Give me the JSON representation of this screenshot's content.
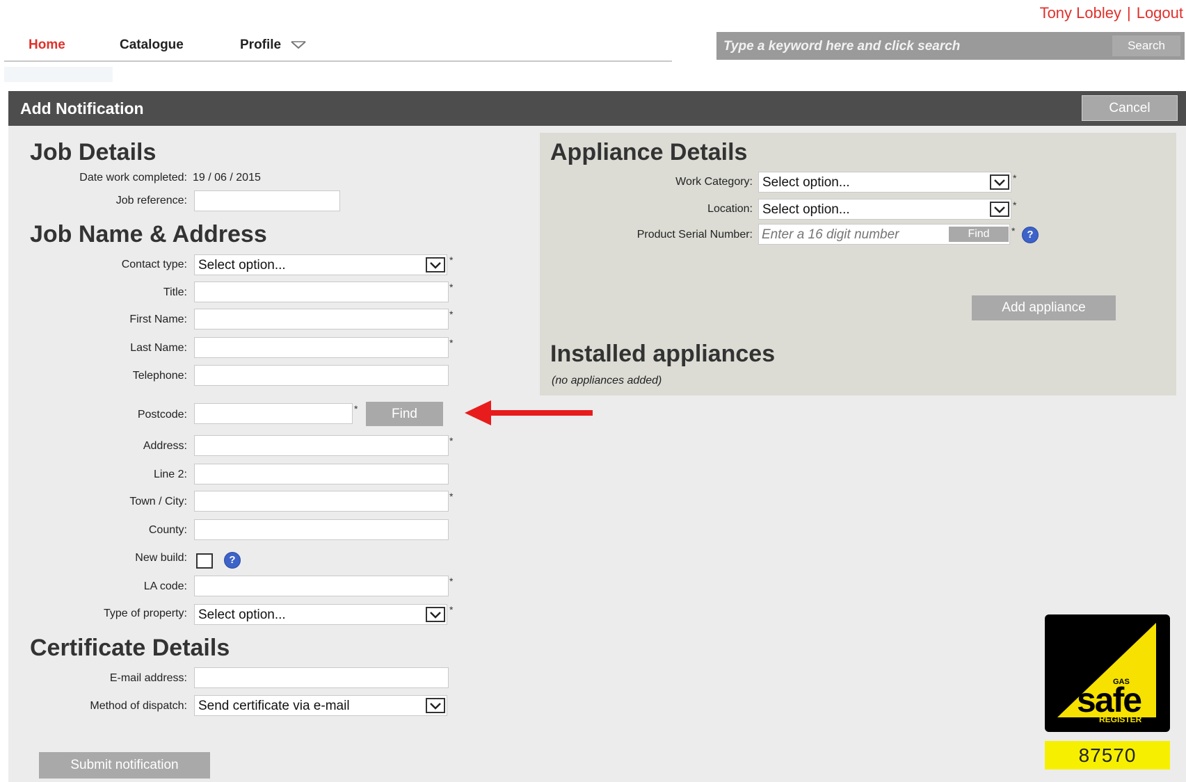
{
  "user": {
    "name": "Tony Lobley",
    "separator": "|",
    "logout": "Logout"
  },
  "nav": {
    "home": "Home",
    "catalogue": "Catalogue",
    "profile": "Profile"
  },
  "search": {
    "placeholder": "Type a keyword here and click search",
    "button": "Search"
  },
  "header": {
    "title": "Add Notification",
    "cancel": "Cancel"
  },
  "job_details": {
    "title": "Job Details",
    "date_label": "Date work completed:",
    "date_value": "19 / 06 / 2015",
    "reference_label": "Job reference:"
  },
  "job_name_address": {
    "title": "Job Name & Address",
    "contact_type_label": "Contact type:",
    "contact_type_value": "Select option...",
    "title_label": "Title:",
    "first_name_label": "First Name:",
    "last_name_label": "Last Name:",
    "telephone_label": "Telephone:",
    "postcode_label": "Postcode:",
    "find_button": "Find",
    "address_label": "Address:",
    "line2_label": "Line 2:",
    "town_label": "Town / City:",
    "county_label": "County:",
    "new_build_label": "New build:",
    "la_code_label": "LA code:",
    "property_type_label": "Type of property:",
    "property_type_value": "Select option..."
  },
  "certificate_details": {
    "title": "Certificate Details",
    "email_label": "E-mail address:",
    "dispatch_label": "Method of dispatch:",
    "dispatch_value": "Send certificate via e-mail"
  },
  "submit": "Submit notification",
  "appliance_details": {
    "title": "Appliance Details",
    "work_category_label": "Work Category:",
    "work_category_value": "Select option...",
    "location_label": "Location:",
    "location_value": "Select option...",
    "serial_label": "Product Serial Number:",
    "serial_placeholder": "Enter a 16 digit number",
    "find_button": "Find",
    "add_button": "Add appliance"
  },
  "installed": {
    "title": "Installed appliances",
    "empty": "(no appliances added)"
  },
  "gas_safe": {
    "logo_small": "GAS",
    "logo_main": "safe",
    "logo_register": "REGISTER",
    "number": "87570"
  },
  "required_marker": "*",
  "help_marker": "?",
  "colors": {
    "accent": "#e0302b",
    "header_bg": "#4d4d4d",
    "button_bg": "#a9a9a9",
    "gas_safe_yellow": "#f6f000",
    "arrow": "#e81c1c"
  }
}
